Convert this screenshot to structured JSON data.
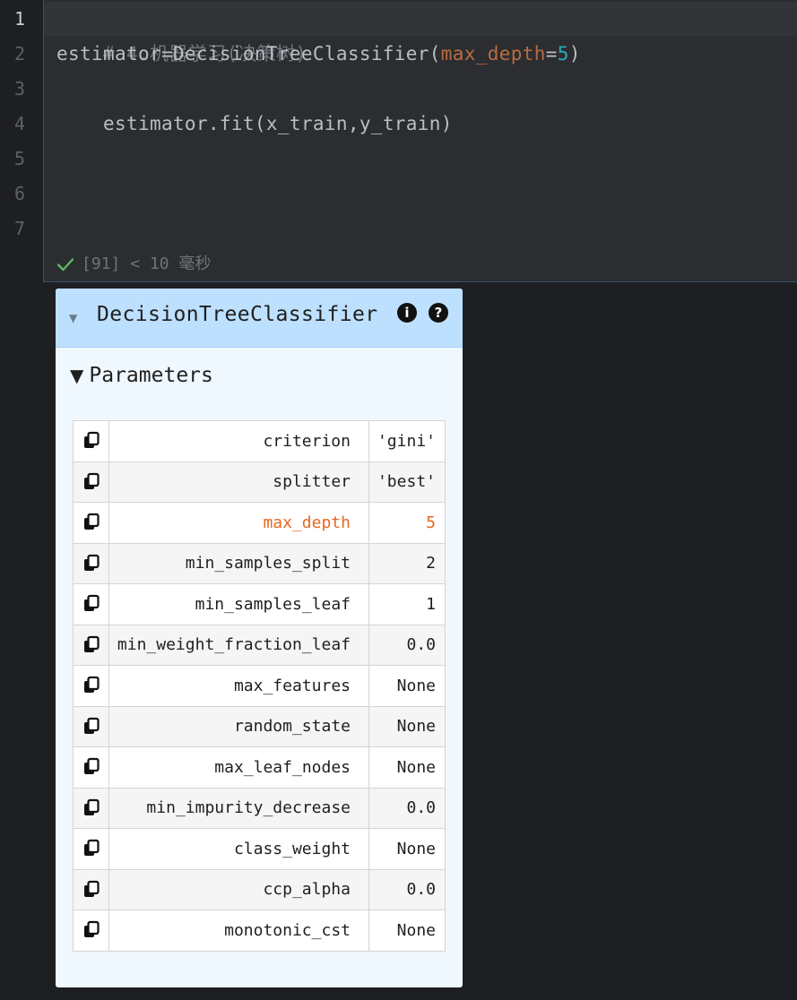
{
  "editor": {
    "line_numbers": [
      "1",
      "2",
      "3",
      "4",
      "5",
      "6",
      "7"
    ],
    "lines": {
      "l1": {
        "comment": "# 4.机器学习(决策树)"
      },
      "l2": {
        "pre": "estimator=DecisionTreeClassifier(",
        "param": "max_depth",
        "eq": "=",
        "num": "5",
        "post": ")"
      },
      "l3": {
        "text": "estimator.fit(x_train,y_train)"
      }
    },
    "status": {
      "text": "[91] < 10 毫秒",
      "icon": "check-icon"
    }
  },
  "output": {
    "title": "DecisionTreeClassifier",
    "info_icon_label": "i",
    "help_icon_label": "?",
    "params_label": "Parameters",
    "params": [
      {
        "name": "criterion",
        "value": "'gini'",
        "changed": false
      },
      {
        "name": "splitter",
        "value": "'best'",
        "changed": false
      },
      {
        "name": "max_depth",
        "value": "5",
        "changed": true
      },
      {
        "name": "min_samples_split",
        "value": "2",
        "changed": false
      },
      {
        "name": "min_samples_leaf",
        "value": "1",
        "changed": false
      },
      {
        "name": "min_weight_fraction_leaf",
        "value": "0.0",
        "changed": false
      },
      {
        "name": "max_features",
        "value": "None",
        "changed": false
      },
      {
        "name": "random_state",
        "value": "None",
        "changed": false
      },
      {
        "name": "max_leaf_nodes",
        "value": "None",
        "changed": false
      },
      {
        "name": "min_impurity_decrease",
        "value": "0.0",
        "changed": false
      },
      {
        "name": "class_weight",
        "value": "None",
        "changed": false
      },
      {
        "name": "ccp_alpha",
        "value": "0.0",
        "changed": false
      },
      {
        "name": "monotonic_cst",
        "value": "None",
        "changed": false
      }
    ]
  },
  "colors": {
    "editor_bg": "#2b2d30",
    "header_bg": "#bde0fe",
    "changed_param": "#e8651f",
    "success_check": "#5fb865"
  }
}
